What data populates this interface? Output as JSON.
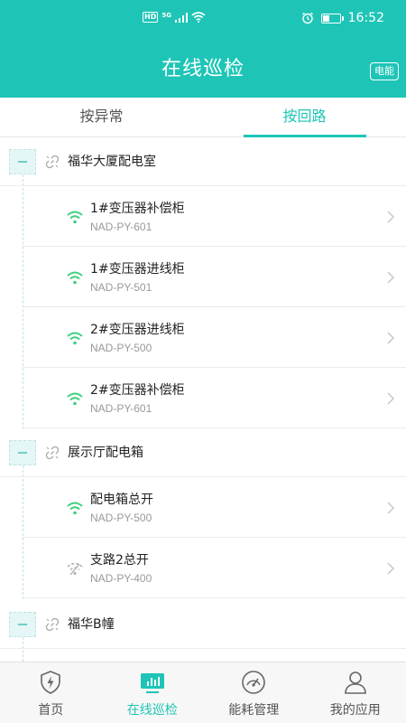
{
  "status_bar": {
    "hd_badge": "HD",
    "network": "5G",
    "time": "16:52",
    "battery_level": 0.35
  },
  "header": {
    "title": "在线巡检",
    "energy_button": "电能"
  },
  "tabs": [
    {
      "label": "按异常",
      "active": false
    },
    {
      "label": "按回路",
      "active": true
    }
  ],
  "groups": [
    {
      "name": "福华大厦配电室",
      "items": [
        {
          "name": "1#变压器补偿柜",
          "code": "NAD-PY-601",
          "online": true
        },
        {
          "name": "1#变压器进线柜",
          "code": "NAD-PY-501",
          "online": true
        },
        {
          "name": "2#变压器进线柜",
          "code": "NAD-PY-500",
          "online": true
        },
        {
          "name": "2#变压器补偿柜",
          "code": "NAD-PY-601",
          "online": true
        }
      ]
    },
    {
      "name": "展示厅配电箱",
      "items": [
        {
          "name": "配电箱总开",
          "code": "NAD-PY-500",
          "online": true
        },
        {
          "name": "支路2总开",
          "code": "NAD-PY-400",
          "online": false
        }
      ]
    },
    {
      "name": "福华B幢",
      "items": []
    }
  ],
  "bottom_nav": [
    {
      "label": "首页",
      "icon": "shield-lightning-icon",
      "active": false
    },
    {
      "label": "在线巡检",
      "icon": "monitor-chart-icon",
      "active": true
    },
    {
      "label": "能耗管理",
      "icon": "gauge-icon",
      "active": false
    },
    {
      "label": "我的应用",
      "icon": "user-icon",
      "active": false
    }
  ],
  "colors": {
    "accent": "#1ec5b6",
    "online": "#3fcf7f",
    "offline": "#b5b5b5"
  }
}
